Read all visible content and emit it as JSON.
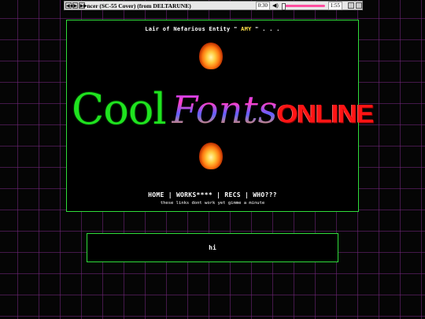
{
  "player": {
    "title": "ncer (SC-55 Cover) (from DELTARUNE)",
    "time": "0:30",
    "volume": "◀)",
    "end_label": "1:55",
    "buttons": [
      "◀◀",
      "▶",
      "▶▶"
    ]
  },
  "header": {
    "prefix": "Lair of Nefarious Entity \"",
    "name": "AMY",
    "suffix": "\" . . ."
  },
  "logo": {
    "cool": "Cool",
    "fonts": "Fonts",
    "online": "ONLINE"
  },
  "nav": {
    "home": "HOME",
    "sep": " | ",
    "works": "WORKS****",
    "recs": "RECS",
    "who": "WHO???",
    "note": "these links dont work yet gimme a minute"
  },
  "hi_box": {
    "text": "hi"
  },
  "colors": {
    "border": "#2fdc3a",
    "accent_name": "#ffe04a",
    "grid": "#782882"
  }
}
